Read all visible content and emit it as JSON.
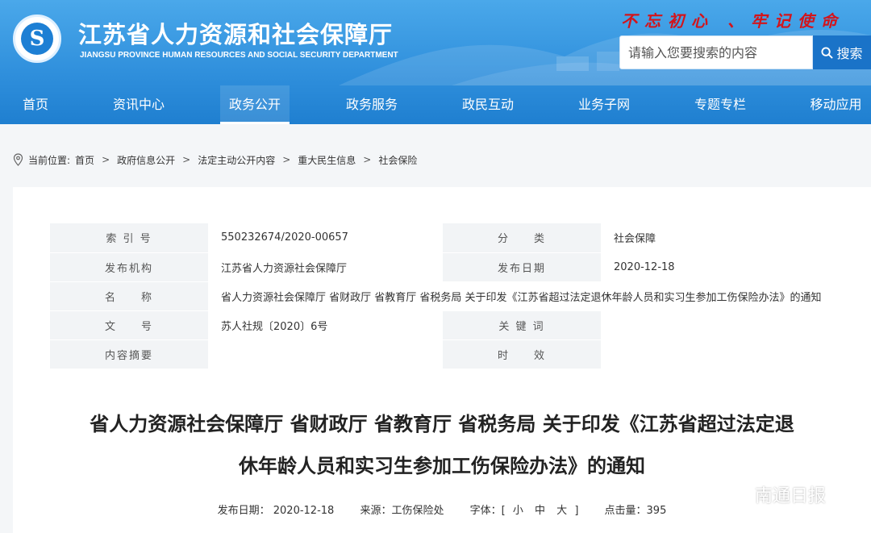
{
  "header": {
    "title": "江苏省人力资源和社会保障厅",
    "subtitle": "JIANGSU PROVINCE HUMAN RESOURCES AND SOCIAL SECURITY DEPARTMENT",
    "slogan": "不忘初心 、牢记使命",
    "search_placeholder": "请输入您要搜索的内容",
    "search_label": "搜索",
    "logo_icon": "circle-emblem-icon"
  },
  "nav": {
    "items": [
      {
        "label": "首页"
      },
      {
        "label": "资讯中心"
      },
      {
        "label": "政务公开"
      },
      {
        "label": "政务服务"
      },
      {
        "label": "政民互动"
      },
      {
        "label": "业务子网"
      },
      {
        "label": "专题专栏"
      },
      {
        "label": "移动应用"
      }
    ],
    "active_index": 2
  },
  "breadcrumb": {
    "prefix": "当前位置:",
    "items": [
      "首页",
      "政府信息公开",
      "法定主动公开内容",
      "重大民生信息",
      "社会保险"
    ],
    "separator": ">"
  },
  "meta": {
    "index_label": "索 引 号",
    "index_value": "550232674/2020-00657",
    "category_label": "分　　类",
    "category_value": "社会保障",
    "publisher_label": "发布机构",
    "publisher_value": "江苏省人力资源社会保障厅",
    "date_label": "发布日期",
    "date_value": "2020-12-18",
    "name_label": "名　　称",
    "name_value": "省人力资源社会保障厅 省财政厅 省教育厅 省税务局 关于印发《江苏省超过法定退休年龄人员和实习生参加工伤保险办法》的通知",
    "docno_label": "文　　号",
    "docno_value": "苏人社规〔2020〕6号",
    "keywords_label": "关 键 词",
    "keywords_value": "",
    "abstract_label": "内容摘要",
    "abstract_value": "",
    "validity_label": "时　　效",
    "validity_value": ""
  },
  "document": {
    "title_line1": "省人力资源社会保障厅 省财政厅 省教育厅 省税务局 关于印发《江苏省超过法定退",
    "title_line2": "休年龄人员和实习生参加工伤保险办法》的通知",
    "date": "发布日期： 2020-12-18",
    "source": "来源：工伤保险处",
    "font_label": "字体：",
    "font_small": "小",
    "font_medium": "中",
    "font_large": "大",
    "bracket_open": "[",
    "bracket_close": "]",
    "views": "点击量：395"
  },
  "watermark": {
    "text": "南通日报",
    "icon": "wechat-icon"
  },
  "colors": {
    "header_blue": "#2f8fdc",
    "search_button": "#1a73c8",
    "slogan_red": "#d3141b"
  }
}
